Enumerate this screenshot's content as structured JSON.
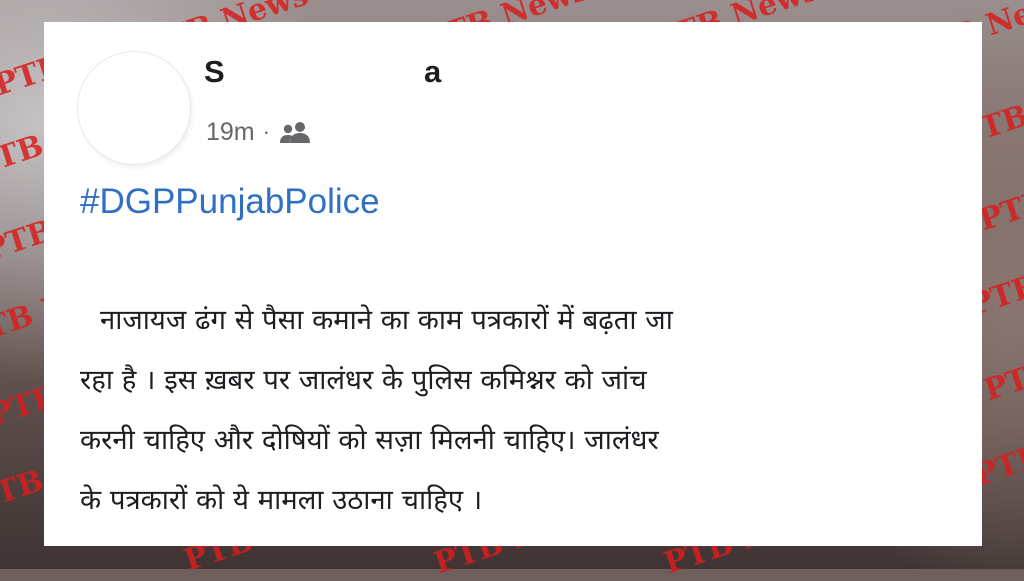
{
  "watermark": "PTB News",
  "post": {
    "author_first": "S",
    "author_last": "a",
    "time": "19m",
    "separator": "·",
    "audience_icon": "friends-icon",
    "hashtag": "#DGPPunjabPolice",
    "lines": [
      "नाजायज ढंग से पैसा कमाने का काम पत्रकारों में बढ़ता जा",
      "रहा है । इस ख़बर पर जालंधर के पुलिस कमिश्नर को जांच",
      "करनी चाहिए और दोषियों को सज़ा मिलनी चाहिए। जालंधर",
      "के पत्रकारों को ये मामला उठाना चाहिए ।"
    ]
  },
  "colors": {
    "watermark": "#d81e1e",
    "hashtag": "#2f6fc4",
    "text": "#1c1e21",
    "meta": "#65676b"
  }
}
